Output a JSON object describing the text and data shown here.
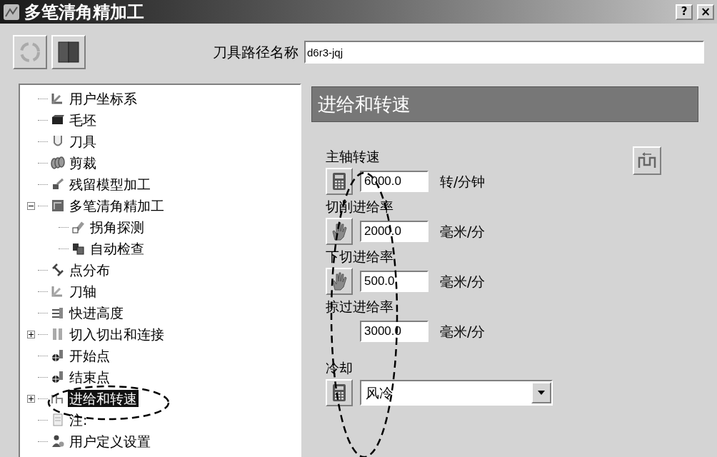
{
  "window": {
    "title": "多笔清角精加工",
    "help_button": "?",
    "close_button": "×"
  },
  "toolpath_name": {
    "label": "刀具路径名称",
    "value": "d6r3-jqj"
  },
  "tree": [
    {
      "label": "用户坐标系",
      "selected": false
    },
    {
      "label": "毛坯",
      "selected": false
    },
    {
      "label": "刀具",
      "selected": false
    },
    {
      "label": "剪裁",
      "selected": false
    },
    {
      "label": "残留模型加工",
      "selected": false
    },
    {
      "label": "多笔清角精加工",
      "selected": false,
      "expanded": true,
      "children": [
        {
          "label": "拐角探测",
          "selected": false
        },
        {
          "label": "自动检查",
          "selected": false
        }
      ]
    },
    {
      "label": "点分布",
      "selected": false
    },
    {
      "label": "刀轴",
      "selected": false
    },
    {
      "label": "快进高度",
      "selected": false
    },
    {
      "label": "切入切出和连接",
      "selected": false,
      "expanded": false
    },
    {
      "label": "开始点",
      "selected": false
    },
    {
      "label": "结束点",
      "selected": false
    },
    {
      "label": "进给和转速",
      "selected": true,
      "expanded": false
    },
    {
      "label": "注:",
      "selected": false
    },
    {
      "label": "用户定义设置",
      "selected": false
    }
  ],
  "panel": {
    "title": "进给和转速",
    "fields": [
      {
        "label": "主轴转速",
        "kind": "calculator",
        "value": "6000.0",
        "unit": "转/分钟"
      },
      {
        "label": "切削进给率",
        "kind": "hand",
        "value": "2000.0",
        "unit": "毫米/分"
      },
      {
        "label": "下切进给率",
        "kind": "hand",
        "value": "500.0",
        "unit": "毫米/分"
      },
      {
        "label": "掠过进给率",
        "kind": "none",
        "value": "3000.0",
        "unit": "毫米/分"
      }
    ],
    "coolant": {
      "label": "冷却",
      "value": "风冷"
    }
  }
}
